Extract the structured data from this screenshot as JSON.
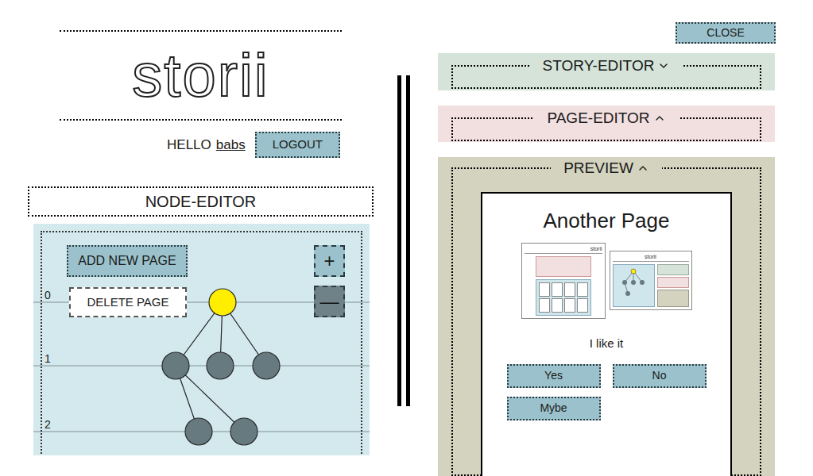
{
  "logo": "storii",
  "user": {
    "greeting": "HELLO",
    "name": "babs"
  },
  "logout": "LOGOUT",
  "node_editor": {
    "title": "NODE-EDITOR",
    "add_button": "ADD NEW PAGE",
    "delete_button": "DELETE PAGE",
    "zoom": [
      {
        "label": "+",
        "selected": false
      },
      {
        "label": "—",
        "selected": true
      }
    ],
    "levels": [
      "0",
      "1",
      "2"
    ],
    "nodes": [
      {
        "level": 0,
        "selected": true,
        "parent": null
      },
      {
        "level": 1,
        "selected": false,
        "parent": 0
      },
      {
        "level": 1,
        "selected": false,
        "parent": 0
      },
      {
        "level": 1,
        "selected": false,
        "parent": 0
      },
      {
        "level": 2,
        "selected": false,
        "parent": 1
      },
      {
        "level": 2,
        "selected": false,
        "parent": 1
      }
    ]
  },
  "close": "CLOSE",
  "panels": [
    {
      "title": "STORY-EDITOR",
      "expanded": false,
      "color": "#d5e3d8"
    },
    {
      "title": "PAGE-EDITOR",
      "expanded": true,
      "color": "#f2dfe0"
    }
  ],
  "preview": {
    "title": "PREVIEW",
    "expanded": true,
    "page_title": "Another Page",
    "thumbnails": [
      {
        "kind": "player",
        "logo": "storii"
      },
      {
        "kind": "editor",
        "logo": "storii"
      }
    ],
    "text": "I like it",
    "choices": [
      "Yes",
      "No",
      "Mybe"
    ]
  }
}
